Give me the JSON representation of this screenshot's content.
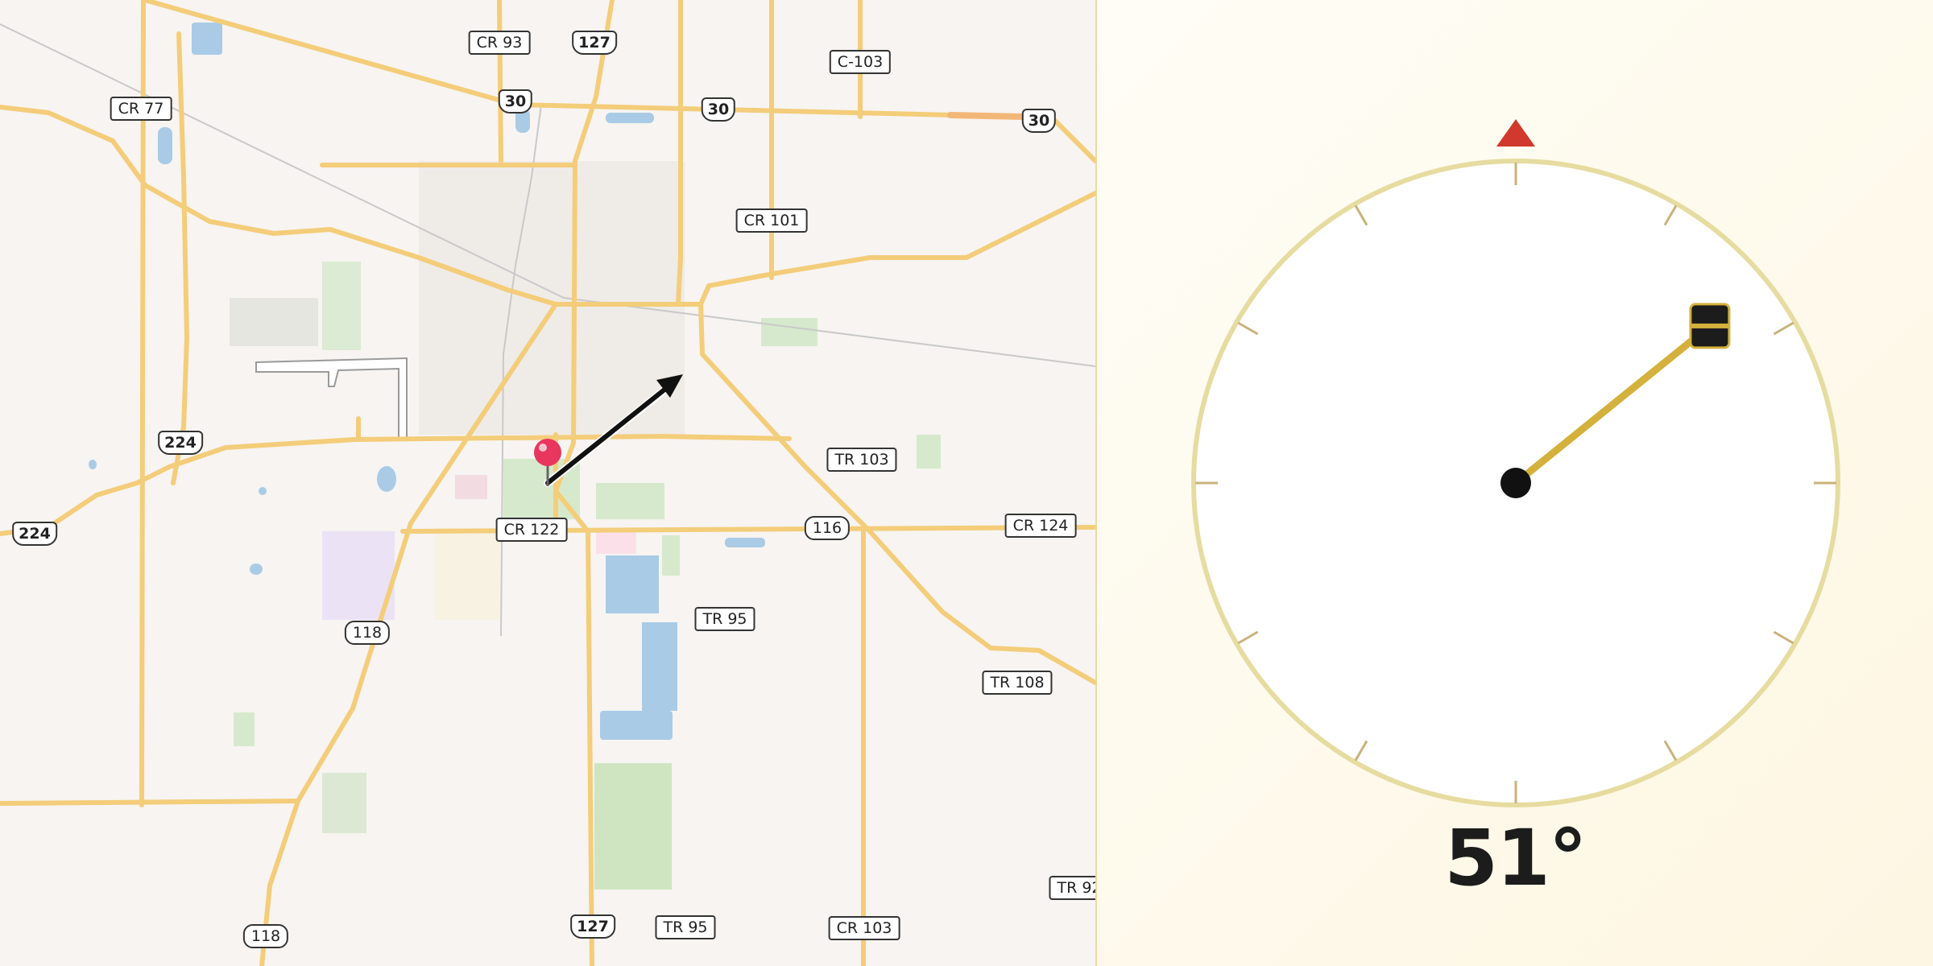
{
  "map": {
    "road_labels": [
      {
        "id": "cr93",
        "text": "CR 93",
        "kind": "county"
      },
      {
        "id": "us127-top",
        "text": "127",
        "kind": "us"
      },
      {
        "id": "c103",
        "text": "C-103",
        "kind": "county"
      },
      {
        "id": "cr77",
        "text": "CR 77",
        "kind": "county"
      },
      {
        "id": "us30-a",
        "text": "30",
        "kind": "us"
      },
      {
        "id": "us30-b",
        "text": "30",
        "kind": "us"
      },
      {
        "id": "us30-c",
        "text": "30",
        "kind": "us"
      },
      {
        "id": "cr101",
        "text": "CR 101",
        "kind": "county"
      },
      {
        "id": "us224-a",
        "text": "224",
        "kind": "us"
      },
      {
        "id": "tr103",
        "text": "TR 103",
        "kind": "county"
      },
      {
        "id": "us224-b",
        "text": "224",
        "kind": "us"
      },
      {
        "id": "cr122",
        "text": "CR 122",
        "kind": "county"
      },
      {
        "id": "r116",
        "text": "116",
        "kind": "state"
      },
      {
        "id": "cr124",
        "text": "CR 124",
        "kind": "county"
      },
      {
        "id": "tr95-a",
        "text": "TR 95",
        "kind": "county"
      },
      {
        "id": "r118-a",
        "text": "118",
        "kind": "state"
      },
      {
        "id": "tr108",
        "text": "TR 108",
        "kind": "county"
      },
      {
        "id": "tr92",
        "text": "TR 92",
        "kind": "county"
      },
      {
        "id": "r118-b",
        "text": "118",
        "kind": "state"
      },
      {
        "id": "us127-bot",
        "text": "127",
        "kind": "us"
      },
      {
        "id": "tr95-b",
        "text": "TR 95",
        "kind": "county"
      },
      {
        "id": "cr103",
        "text": "CR 103",
        "kind": "county"
      }
    ],
    "marker": {
      "icon": "map-pin-icon",
      "color": "#e8365e"
    },
    "direction_arrow": {
      "icon": "direction-arrow-icon",
      "bearing_deg": 51
    }
  },
  "compass": {
    "heading_deg": 51,
    "heading_text": "51°",
    "north_marker_color": "#d0392b",
    "needle_color": "#d4b13c",
    "rim_color": "#e6dca0"
  }
}
